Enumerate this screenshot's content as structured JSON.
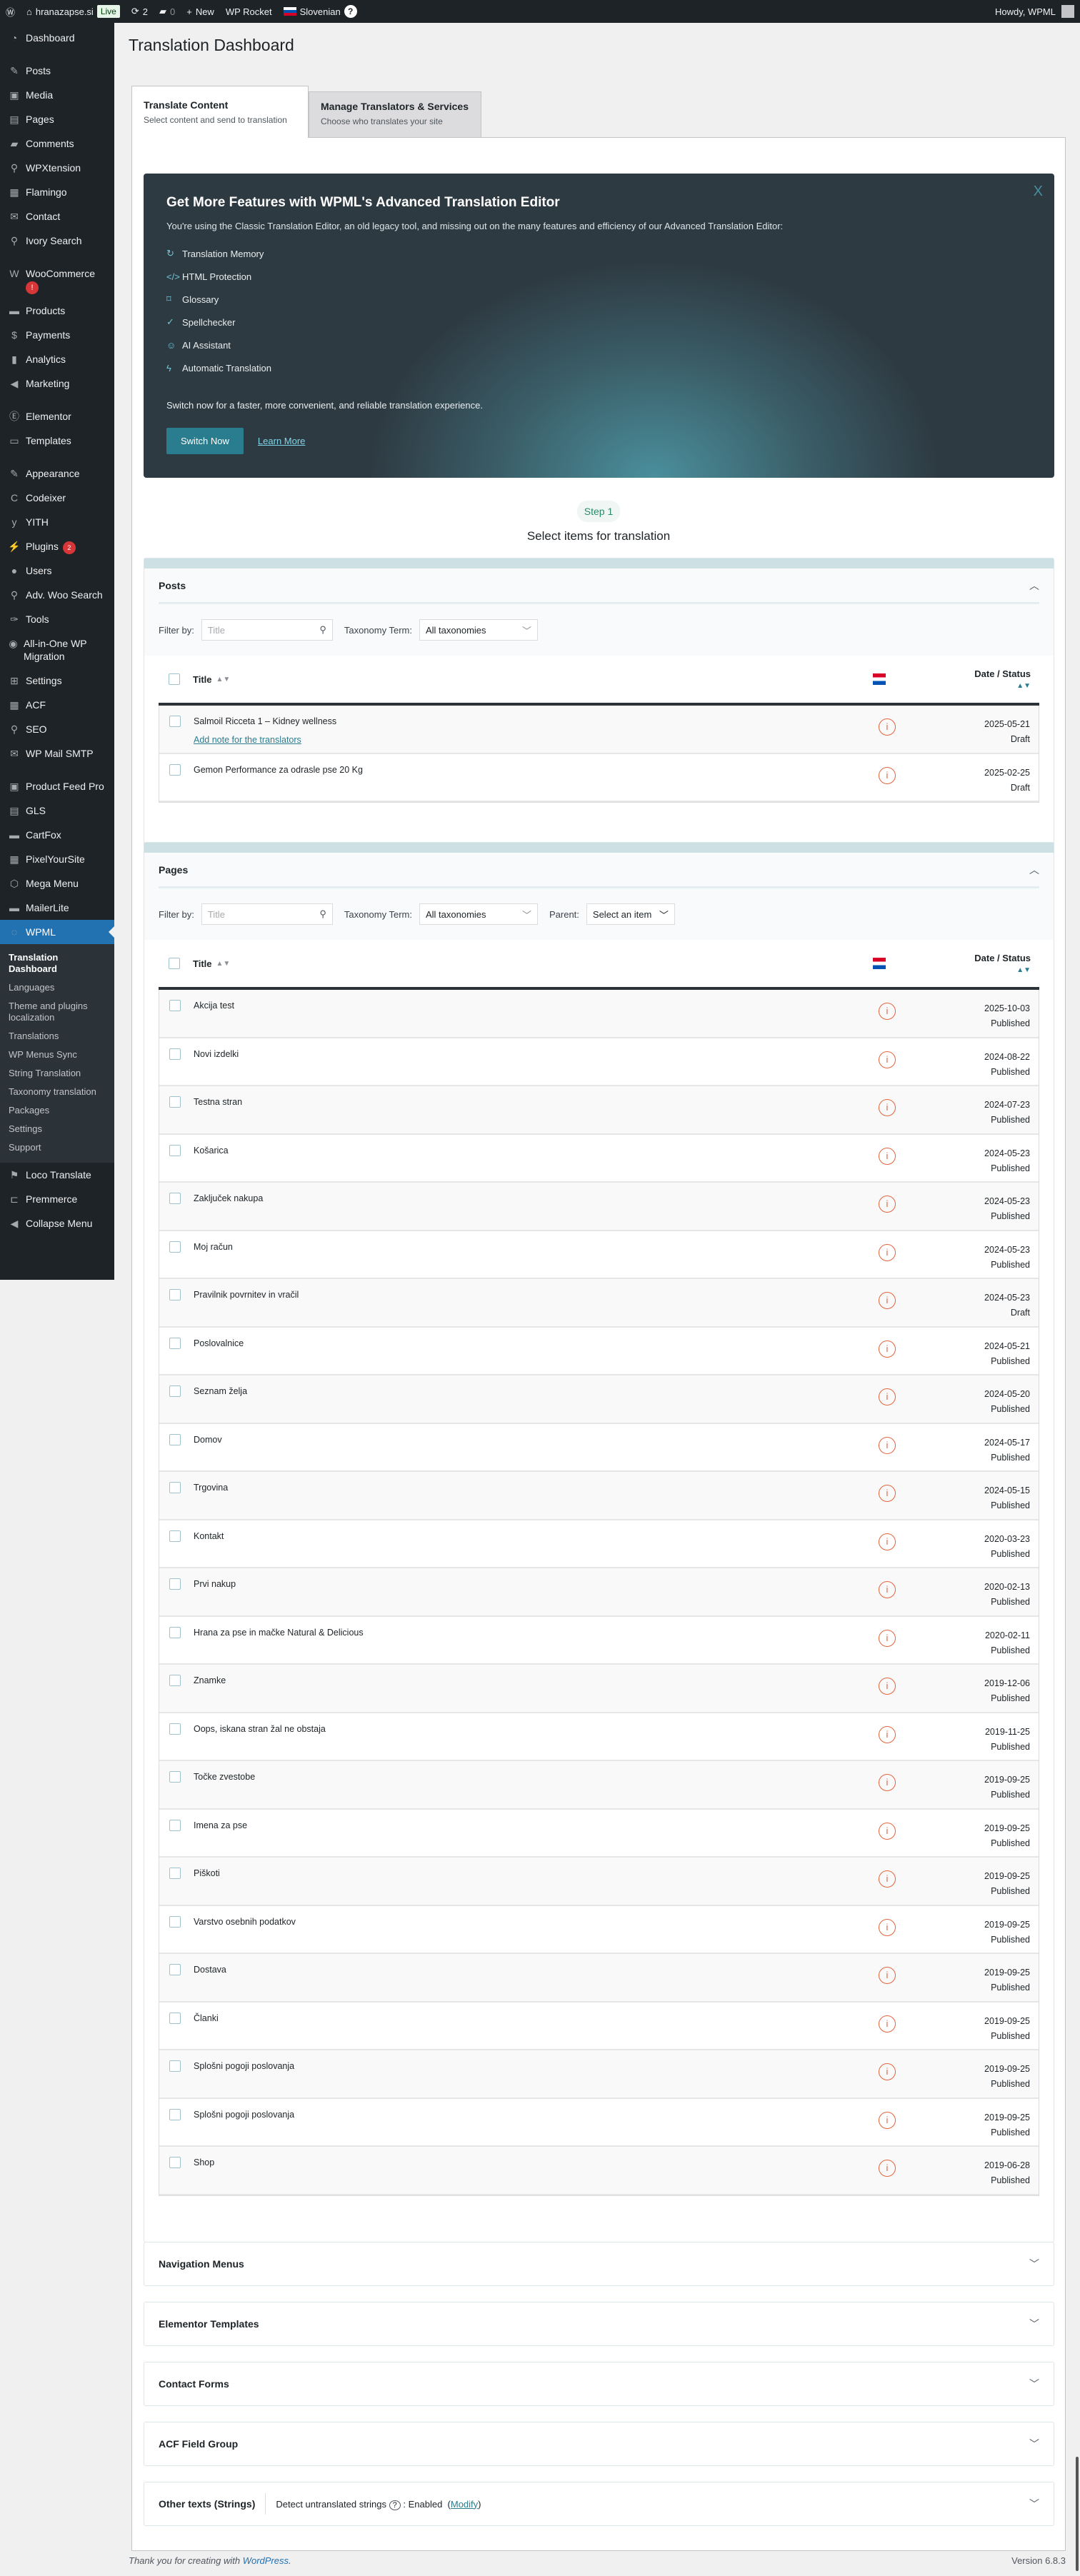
{
  "adminbar": {
    "site": "hranazapse.si",
    "live": "Live",
    "updates": "2",
    "comments": "0",
    "new": "New",
    "rocket": "WP Rocket",
    "language": "Slovenian",
    "howdy": "Howdy, WPML"
  },
  "sidebar": {
    "items": [
      {
        "label": "Dashboard",
        "icon": "dashboard-icon",
        "glyph": "◔"
      },
      {
        "sep": true
      },
      {
        "label": "Posts",
        "icon": "pin-icon",
        "glyph": "✎"
      },
      {
        "label": "Media",
        "icon": "media-icon",
        "glyph": "▣"
      },
      {
        "label": "Pages",
        "icon": "pages-icon",
        "glyph": "▤"
      },
      {
        "label": "Comments",
        "icon": "comment-icon",
        "glyph": "▰"
      },
      {
        "label": "WPXtension",
        "icon": "plug-icon",
        "glyph": "⚲"
      },
      {
        "label": "Flamingo",
        "icon": "flamingo-icon",
        "glyph": "▦"
      },
      {
        "label": "Contact",
        "icon": "mail-icon",
        "glyph": "✉"
      },
      {
        "label": "Ivory Search",
        "icon": "search-icon",
        "glyph": "⚲"
      },
      {
        "sep": true
      },
      {
        "label": "WooCommerce",
        "icon": "woocommerce-icon",
        "glyph": "W",
        "badge": "!"
      },
      {
        "label": "Products",
        "icon": "archive-icon",
        "glyph": "▬"
      },
      {
        "label": "Payments",
        "icon": "dollar-icon",
        "glyph": "$"
      },
      {
        "label": "Analytics",
        "icon": "chart-icon",
        "glyph": "▮"
      },
      {
        "label": "Marketing",
        "icon": "megaphone-icon",
        "glyph": "◀"
      },
      {
        "sep": true
      },
      {
        "label": "Elementor",
        "icon": "elementor-icon",
        "glyph": "Ⓔ"
      },
      {
        "label": "Templates",
        "icon": "folder-icon",
        "glyph": "▭"
      },
      {
        "sep": true
      },
      {
        "label": "Appearance",
        "icon": "brush-icon",
        "glyph": "✎"
      },
      {
        "label": "Codeixer",
        "icon": "codeixer-icon",
        "glyph": "C"
      },
      {
        "label": "YITH",
        "icon": "yith-icon",
        "glyph": "y"
      },
      {
        "label": "Plugins",
        "icon": "plugin-icon",
        "glyph": "⚡",
        "count": "2"
      },
      {
        "label": "Users",
        "icon": "user-icon",
        "glyph": "●"
      },
      {
        "label": "Adv. Woo Search",
        "icon": "search-icon",
        "glyph": "⚲"
      },
      {
        "label": "Tools",
        "icon": "wrench-icon",
        "glyph": "✑"
      },
      {
        "label": "All-in-One WP Migration",
        "icon": "migration-icon",
        "glyph": "◉",
        "tall": true
      },
      {
        "label": "Settings",
        "icon": "settings-icon",
        "glyph": "⊞"
      },
      {
        "label": "ACF",
        "icon": "acf-icon",
        "glyph": "▦"
      },
      {
        "label": "SEO",
        "icon": "search-icon",
        "glyph": "⚲"
      },
      {
        "label": "WP Mail SMTP",
        "icon": "mail-smtp-icon",
        "glyph": "✉"
      },
      {
        "sep": true
      },
      {
        "label": "Product Feed Pro",
        "icon": "feed-icon",
        "glyph": "▣"
      },
      {
        "label": "GLS",
        "icon": "gls-icon",
        "glyph": "▤"
      },
      {
        "label": "CartFox",
        "icon": "cartfox-icon",
        "glyph": "▬"
      },
      {
        "label": "PixelYourSite",
        "icon": "pixel-icon",
        "glyph": "▦"
      },
      {
        "label": "Mega Menu",
        "icon": "megamenu-icon",
        "glyph": "⬡"
      },
      {
        "label": "MailerLite",
        "icon": "mailerlite-icon",
        "glyph": "▬"
      },
      {
        "label": "WPML",
        "icon": "wpml-icon",
        "glyph": "◌",
        "active": true
      }
    ],
    "submenu": [
      "Translation Dashboard",
      "Languages",
      "Theme and plugins localization",
      "Translations",
      "WP Menus Sync",
      "String Translation",
      "Taxonomy translation",
      "Packages",
      "Settings",
      "Support"
    ],
    "after": [
      {
        "label": "Loco Translate",
        "icon": "loco-icon",
        "glyph": "⚑"
      },
      {
        "label": "Premmerce",
        "icon": "premmerce-icon",
        "glyph": "⊏"
      },
      {
        "label": "Collapse Menu",
        "icon": "collapse-icon",
        "glyph": "◀"
      }
    ]
  },
  "page": {
    "title": "Translation Dashboard"
  },
  "tabs": [
    {
      "title": "Translate Content",
      "sub": "Select content and send to translation"
    },
    {
      "title": "Manage Translators & Services",
      "sub": "Choose who translates your site"
    }
  ],
  "banner": {
    "title": "Get More Features with WPML's Advanced Translation Editor",
    "intro": "You're using the Classic Translation Editor, an old legacy tool, and missing out on the many features and efficiency of our Advanced Translation Editor:",
    "features": [
      {
        "label": "Translation Memory",
        "icon": "history-icon",
        "glyph": "↻"
      },
      {
        "label": "HTML Protection",
        "icon": "code-icon",
        "glyph": "</>"
      },
      {
        "label": "Glossary",
        "icon": "bookmark-icon",
        "glyph": "⌑"
      },
      {
        "label": "Spellchecker",
        "icon": "spellcheck-icon",
        "glyph": "✓"
      },
      {
        "label": "AI Assistant",
        "icon": "robot-icon",
        "glyph": "☺"
      },
      {
        "label": "Automatic Translation",
        "icon": "bolt-icon",
        "glyph": "ϟ"
      }
    ],
    "switch_text": "Switch now for a faster, more convenient, and reliable translation experience.",
    "switch_button": "Switch Now",
    "learn_more": "Learn More",
    "close": "X"
  },
  "step": {
    "badge": "Step 1",
    "title": "Select items for translation"
  },
  "filters": {
    "filter_by": "Filter by:",
    "title_placeholder": "Title",
    "taxonomy_label": "Taxonomy Term:",
    "taxonomy_value": "All taxonomies",
    "parent_label": "Parent:",
    "parent_value": "Select an item"
  },
  "table": {
    "col_title": "Title",
    "col_date": "Date / Status",
    "flag": "croatian-flag"
  },
  "posts": {
    "title": "Posts",
    "rows": [
      {
        "title": "Salmoil Ricceta 1 – Kidney wellness",
        "note": "Add note for the translators",
        "date": "2025-05-21",
        "status": "Draft"
      },
      {
        "title": "Gemon Performance za odrasle pse 20 Kg",
        "date": "2025-02-25",
        "status": "Draft"
      }
    ]
  },
  "pages": {
    "title": "Pages",
    "rows": [
      {
        "title": "Akcija test",
        "date": "2025-10-03",
        "status": "Published"
      },
      {
        "title": "Novi izdelki",
        "date": "2024-08-22",
        "status": "Published"
      },
      {
        "title": "Testna stran",
        "date": "2024-07-23",
        "status": "Published"
      },
      {
        "title": "Košarica",
        "date": "2024-05-23",
        "status": "Published"
      },
      {
        "title": "Zaključek nakupa",
        "date": "2024-05-23",
        "status": "Published"
      },
      {
        "title": "Moj račun",
        "date": "2024-05-23",
        "status": "Published"
      },
      {
        "title": "Pravilnik povrnitev in vračil",
        "date": "2024-05-23",
        "status": "Draft"
      },
      {
        "title": "Poslovalnice",
        "date": "2024-05-21",
        "status": "Published"
      },
      {
        "title": "Seznam želja",
        "date": "2024-05-20",
        "status": "Published"
      },
      {
        "title": "Domov",
        "date": "2024-05-17",
        "status": "Published"
      },
      {
        "title": "Trgovina",
        "date": "2024-05-15",
        "status": "Published"
      },
      {
        "title": "Kontakt",
        "date": "2020-03-23",
        "status": "Published"
      },
      {
        "title": "Prvi nakup",
        "date": "2020-02-13",
        "status": "Published"
      },
      {
        "title": "Hrana za pse in mačke Natural & Delicious",
        "date": "2020-02-11",
        "status": "Published"
      },
      {
        "title": "Znamke",
        "date": "2019-12-06",
        "status": "Published"
      },
      {
        "title": "Oops, iskana stran žal ne obstaja",
        "date": "2019-11-25",
        "status": "Published"
      },
      {
        "title": "Točke zvestobe",
        "date": "2019-09-25",
        "status": "Published"
      },
      {
        "title": "Imena za pse",
        "date": "2019-09-25",
        "status": "Published"
      },
      {
        "title": "Piškoti",
        "date": "2019-09-25",
        "status": "Published"
      },
      {
        "title": "Varstvo osebnih podatkov",
        "date": "2019-09-25",
        "status": "Published"
      },
      {
        "title": "Dostava",
        "date": "2019-09-25",
        "status": "Published"
      },
      {
        "title": "Članki",
        "date": "2019-09-25",
        "status": "Published"
      },
      {
        "title": "Splošni pogoji poslovanja",
        "date": "2019-09-25",
        "status": "Published"
      },
      {
        "title": "Splošni pogoji poslovanja",
        "date": "2019-09-25",
        "status": "Published"
      },
      {
        "title": "Shop",
        "date": "2019-06-28",
        "status": "Published"
      }
    ]
  },
  "collapsed": [
    "Navigation Menus",
    "Elementor Templates",
    "Contact Forms",
    "ACF Field Group"
  ],
  "strings": {
    "title": "Other texts (Strings)",
    "detect": "Detect untranslated strings",
    "status": "Enabled",
    "modify": "Modify"
  },
  "footer": {
    "thanks": "Thank you for creating with",
    "wp": "WordPress",
    "version": "Version 6.8.3"
  },
  "colors": {
    "accent": "#2a7d8e",
    "wp_blue": "#2271b1",
    "warning": "#e2633c"
  }
}
